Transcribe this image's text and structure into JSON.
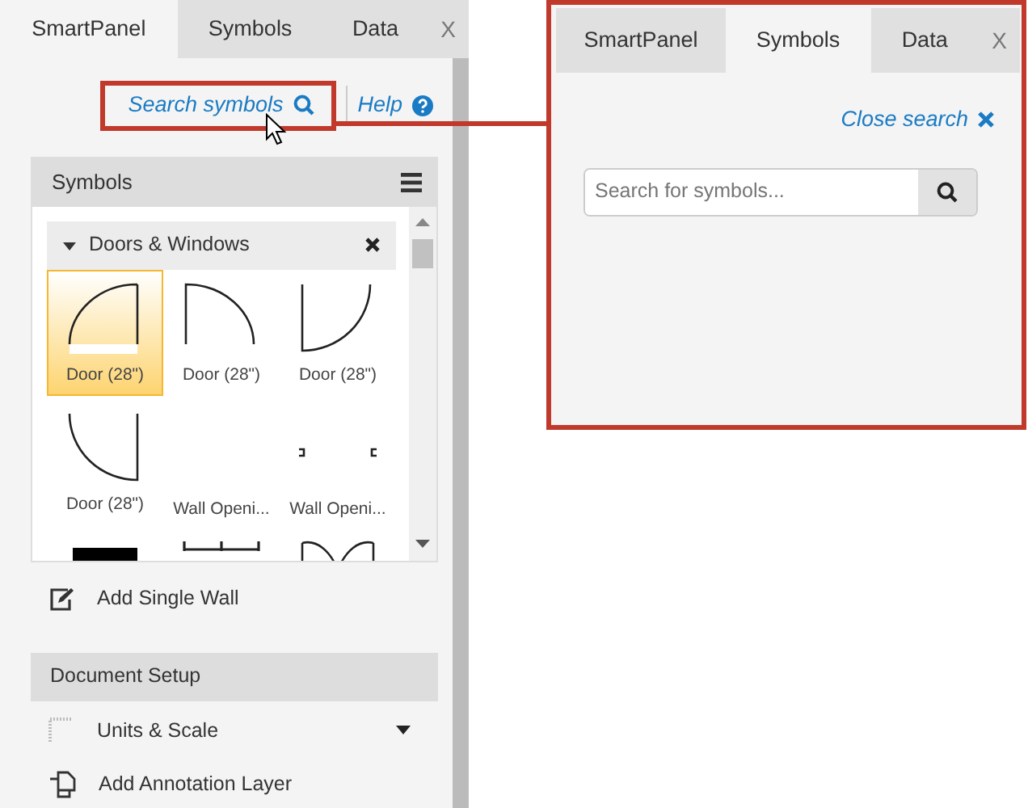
{
  "left_panel": {
    "tabs": [
      {
        "label": "SmartPanel",
        "selected": true
      },
      {
        "label": "Symbols",
        "selected": false
      },
      {
        "label": "Data",
        "selected": false
      }
    ],
    "close_glyph": "X",
    "links": [
      {
        "kind": "search",
        "label": "Search symbols",
        "highlighted": true
      },
      {
        "kind": "help",
        "label": "Help",
        "highlighted": false
      }
    ],
    "symbols_panel": {
      "title": "Symbols",
      "category": {
        "label": "Doors & Windows",
        "expanded": true
      },
      "items": [
        {
          "kind": "door-a",
          "label": "Door (28\")",
          "selected": true
        },
        {
          "kind": "door-b",
          "label": "Door (28\")",
          "selected": false
        },
        {
          "kind": "door-c",
          "label": "Door (28\")",
          "selected": false
        },
        {
          "kind": "door-d",
          "label": "Door (28\")",
          "selected": false
        },
        {
          "kind": "blank",
          "label": "Wall Openi...",
          "selected": false
        },
        {
          "kind": "opening",
          "label": "Wall Openi...",
          "selected": false
        },
        {
          "kind": "block",
          "selected": false
        },
        {
          "kind": "studs",
          "selected": false
        },
        {
          "kind": "double-door",
          "selected": false
        }
      ]
    },
    "actions": [
      {
        "kind": "edit",
        "label": "Add Single Wall"
      }
    ],
    "sections": [
      {
        "title": "Document Setup",
        "items": [
          {
            "kind": "ruler",
            "label": "Units & Scale",
            "has_menu": true
          },
          {
            "kind": "layer",
            "label": "Add Annotation Layer",
            "has_menu": false
          }
        ]
      }
    ]
  },
  "callout": {
    "tabs": [
      {
        "label": "SmartPanel",
        "selected": false
      },
      {
        "label": "Symbols",
        "selected": true
      },
      {
        "label": "Data",
        "selected": false
      }
    ],
    "close_glyph": "X",
    "close_search": "Close search",
    "search": {
      "placeholder": "Search for symbols..."
    }
  }
}
